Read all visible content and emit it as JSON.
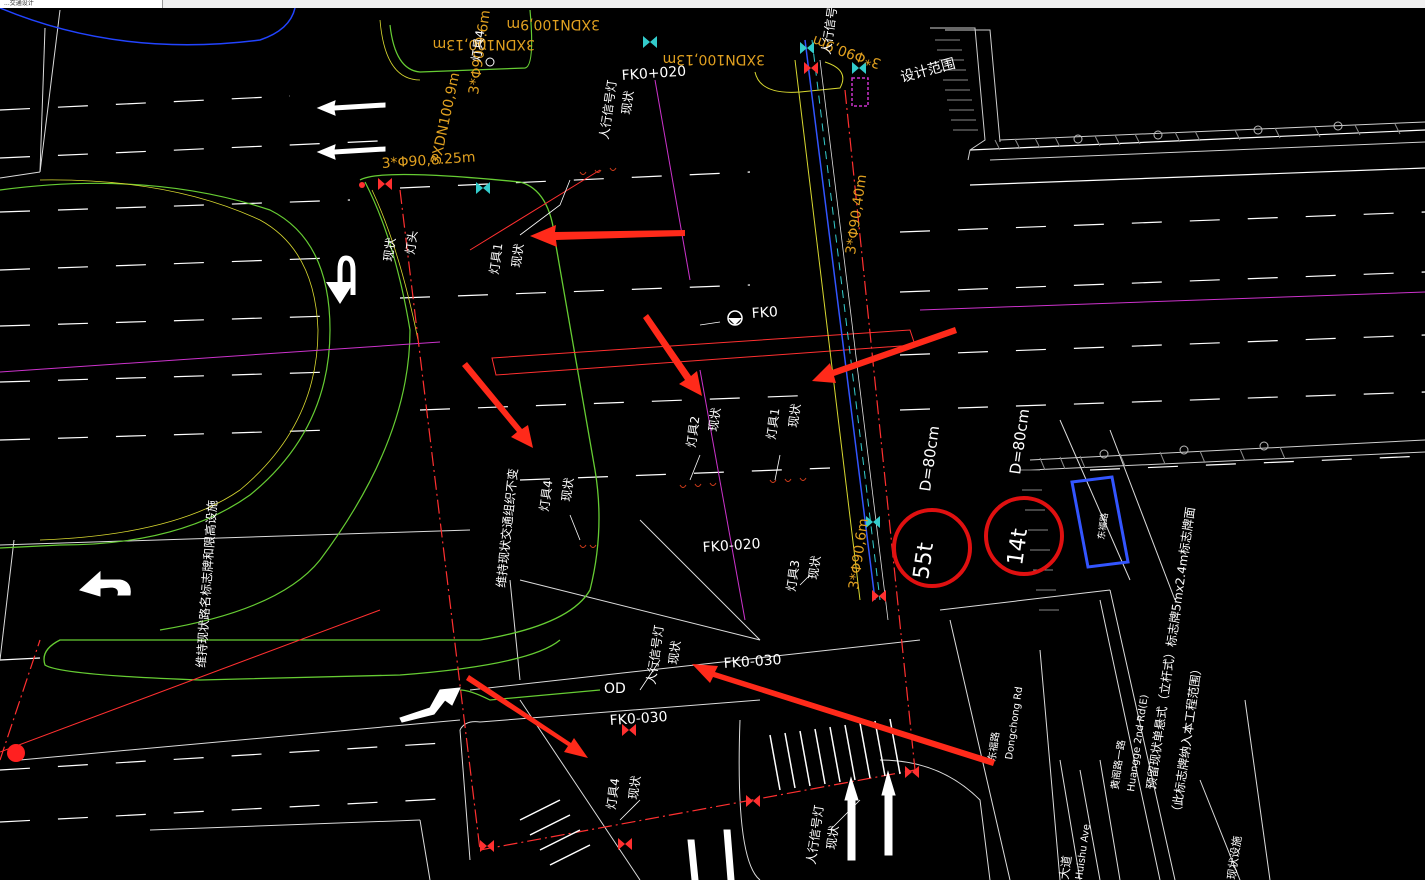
{
  "window": {
    "tab_label": "...交通设计"
  },
  "drawing": {
    "background": "#000000",
    "colors": {
      "lane": "#ffffff",
      "median_green": "#66cc33",
      "median_yellow": "#d8d830",
      "curb": "#c8c8c8",
      "red_dash": "#ff3030",
      "magenta": "#cc33cc",
      "orange_text": "#e0a020",
      "cyan": "#33cccc",
      "blue": "#3355ff",
      "arrow_red": "#ff2a1a",
      "circle_red": "#e01010"
    },
    "labels": {
      "fk0": "FK0",
      "fk0_020_top": "FK0+020",
      "fk0_020_mid": "FK0-020",
      "fk0_030_a": "FK0-030",
      "fk0_030_b": "FK0-030",
      "od": "OD",
      "design_scope": "设计范围",
      "cable_top_a": "3*Φ90,9.6m",
      "cable_top_b": "3XDN100,9m",
      "cable_top_c": "3XDN100,13m",
      "cable_right_top": "3*Φ90,9m",
      "cable_left": "3*Φ90,8.25m",
      "cable_vertical": "3*Φ90,40m",
      "cable_lower": "3*Φ90,6m",
      "ped_signal_top_a": "人行信号灯",
      "ped_signal_top_b": "现状",
      "ped_signal_right": "人行信号灯",
      "ped_signal_mid": "人行信号灯",
      "ped_signal_mid_b": "现状",
      "ped_signal_bottom": "人行信号灯",
      "ped_signal_bottom_b": "现状",
      "lamp1": "灯具1",
      "lamp1b": "现状",
      "lamp2": "灯具2",
      "lamp2b": "现状",
      "lamp3": "灯具3",
      "lamp3b": "现状",
      "lamp4": "灯具4",
      "lamp4b": "现状",
      "lamp1_right": "灯具1",
      "lamp1_right_b": "现状",
      "lamp4_bottom": "灯具4",
      "lamp4_bottom_b": "现状",
      "lamp_top": "灯具4",
      "existing_left": "现状",
      "existing_left_b": "灯头",
      "left_sign": "维持现状路名标志牌和限高设施",
      "mid_sign": "维持现状交通组织不变",
      "d80_left": "D=80cm",
      "d80_right": "D=80cm",
      "circle_left": "55t",
      "circle_right": "14t",
      "blue_box": "东福路",
      "road_cn": "东福路",
      "road_en": "Dongchong Rd",
      "road2_cn": "黄阁路一路",
      "road2_en": "Huangge 2nd Rd(E)",
      "road3_cn": "大道",
      "road3_en": "Huishu Ave",
      "sign_panel_a": "预留现状单悬式（立杆式）标志牌5mx2.4m标志牌面",
      "sign_panel_b": "（此标志牌纳入本工程范围）",
      "bottom_right": "现状设施"
    }
  }
}
